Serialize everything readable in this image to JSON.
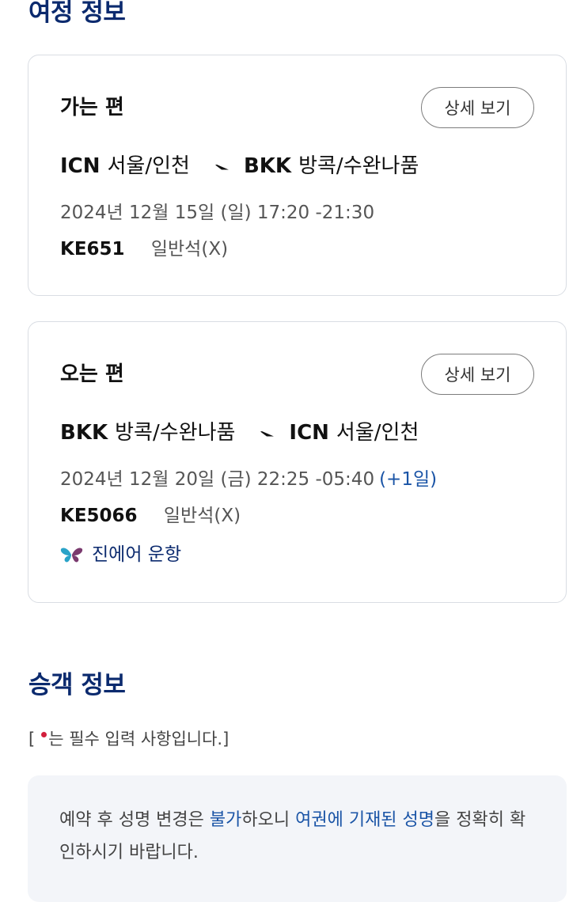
{
  "itinerary": {
    "title": "여정 정보",
    "outbound": {
      "heading": "가는 편",
      "detail_label": "상세 보기",
      "from_code": "ICN",
      "from_city": "서울/인천",
      "to_code": "BKK",
      "to_city": "방콕/수완나품",
      "date_time": "2024년 12월 15일 (일) 17:20 -21:30",
      "flight_no": "KE651",
      "cabin": "일반석(X)"
    },
    "inbound": {
      "heading": "오는 편",
      "detail_label": "상세 보기",
      "from_code": "BKK",
      "from_city": "방콕/수완나품",
      "to_code": "ICN",
      "to_city": "서울/인천",
      "date_time": "2024년 12월 20일 (금) 22:25 -05:40",
      "next_day": "(+1일)",
      "flight_no": "KE5066",
      "cabin": "일반석(X)",
      "operator": "진에어 운항",
      "operator_icon": "jinair-butterfly-logo"
    },
    "route_icon": "plane-arrow-icon"
  },
  "passenger": {
    "title": "승객 정보",
    "required_prefix": "[",
    "required_text": "는 필수 입력 사항입니다.]",
    "notice": {
      "part1": "예약 후 성명 변경은 ",
      "hl1": "불가",
      "part2": "하오니 ",
      "hl2": "여권에 기재된 성명",
      "part3": "을 정확히 확인하시기 바랍니다."
    }
  },
  "colors": {
    "title": "#0b2a6e",
    "link": "#1a54a6",
    "required_dot": "#d21f3c",
    "notice_bg": "#f3f5f9",
    "card_border": "#d9dde3"
  }
}
